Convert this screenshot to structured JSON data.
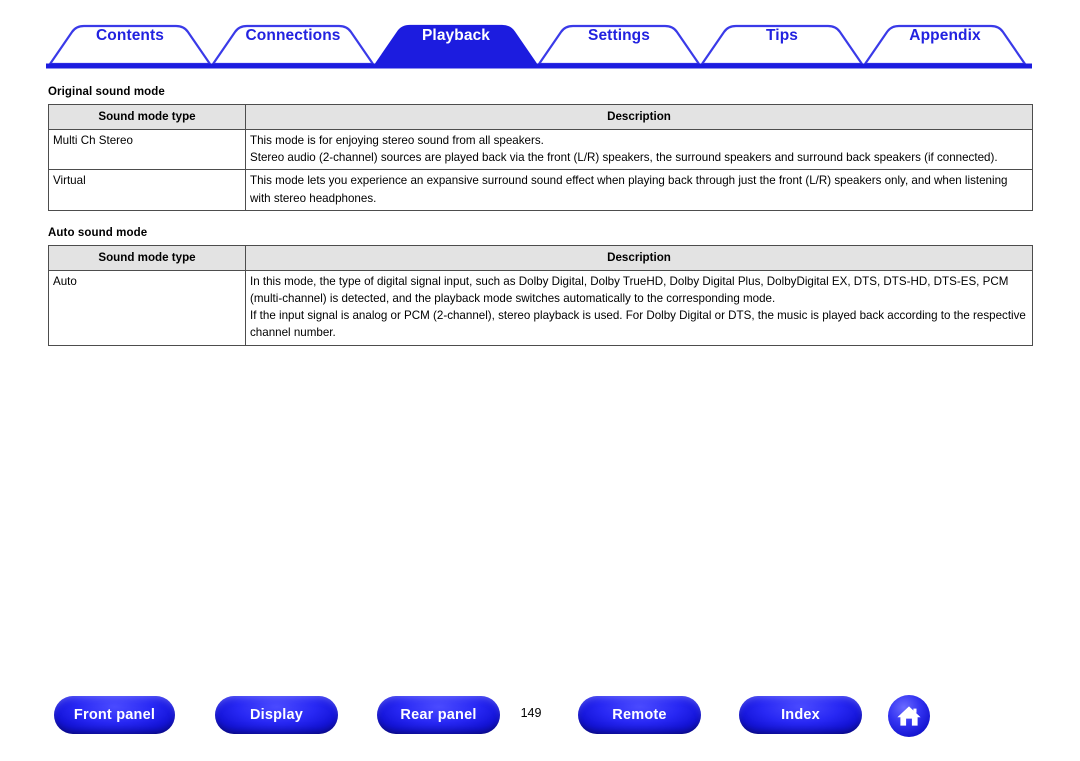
{
  "nav": {
    "tabs": [
      {
        "label": "Contents",
        "active": false
      },
      {
        "label": "Connections",
        "active": false
      },
      {
        "label": "Playback",
        "active": true
      },
      {
        "label": "Settings",
        "active": false
      },
      {
        "label": "Tips",
        "active": false
      },
      {
        "label": "Appendix",
        "active": false
      }
    ],
    "accent_color": "#2222E0",
    "active_text_color": "#FFFFFF"
  },
  "sections": [
    {
      "title": "Original sound mode",
      "columns": [
        "Sound mode type",
        "Description"
      ],
      "rows": [
        {
          "type": "Multi Ch Stereo",
          "description": [
            "This mode is for enjoying stereo sound from all speakers.",
            "Stereo audio (2-channel) sources are played back via the front (L/R) speakers, the surround speakers and surround back speakers (if connected)."
          ]
        },
        {
          "type": "Virtual",
          "description": [
            "This mode lets you experience an expansive surround sound effect when playing back through just the front (L/R) speakers only, and when listening with stereo headphones."
          ]
        }
      ]
    },
    {
      "title": "Auto sound mode",
      "columns": [
        "Sound mode type",
        "Description"
      ],
      "rows": [
        {
          "type": "Auto",
          "description": [
            "In this mode, the type of digital signal input, such as Dolby Digital, Dolby TrueHD, Dolby Digital Plus, DolbyDigital EX, DTS, DTS-HD, DTS-ES, PCM (multi-channel) is detected, and the playback mode switches automatically to the corresponding mode.",
            "If the input signal is analog or PCM (2-channel), stereo playback is used. For Dolby Digital or DTS, the music is played back according to the respective channel number."
          ]
        }
      ]
    }
  ],
  "footer": {
    "buttons": [
      {
        "label": "Front panel"
      },
      {
        "label": "Display"
      },
      {
        "label": "Rear panel"
      },
      {
        "label": "Remote"
      },
      {
        "label": "Index"
      }
    ],
    "page_number": "149",
    "home_icon": "home-icon",
    "button_color": "#1E1EE0"
  }
}
